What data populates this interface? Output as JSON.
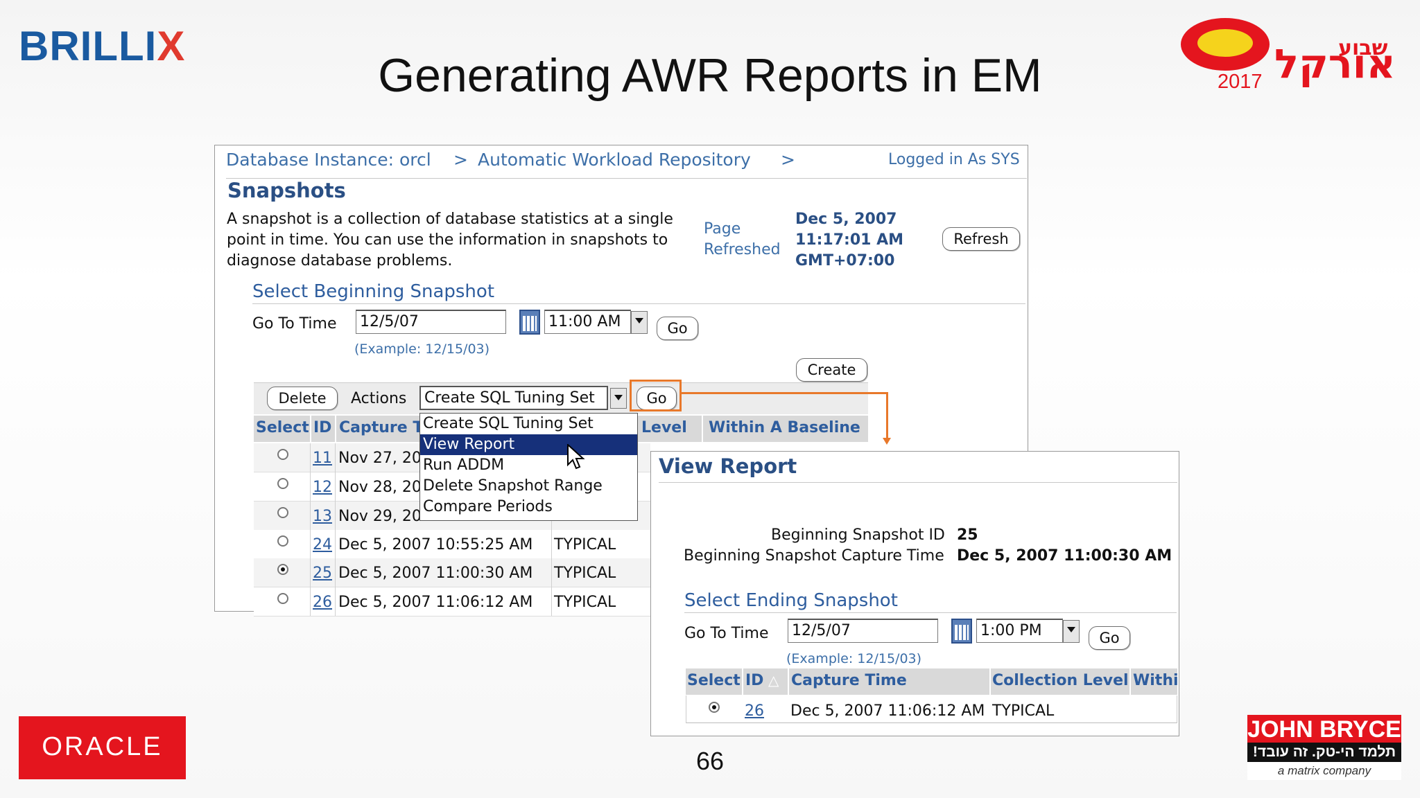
{
  "slide": {
    "title": "Generating AWR Reports in EM",
    "page_number": "66",
    "logos": {
      "brillix_main": "BRILLI",
      "brillix_x": "X",
      "oracle": "ORACLE",
      "john_bryce": "JOHN BRYCE",
      "john_bryce_tagline": "!תלמד הי-טק. זה עובד",
      "john_bryce_company": "a matrix company",
      "orakel_small": "שבוע",
      "orakel_main": "אורקל",
      "orakel_year": "2017"
    },
    "colors": {
      "accent_red": "#e4151e",
      "brillix_blue": "#1a5aa0",
      "highlight_orange": "#e8782a",
      "menu_selected": "#16307a"
    }
  },
  "snapshots_page": {
    "breadcrumb": {
      "item1": "Database Instance: orcl",
      "sep1": ">",
      "item2": "Automatic Workload Repository",
      "sep2": ">"
    },
    "logged_in": "Logged in As SYS",
    "heading": "Snapshots",
    "description": [
      "A snapshot is a collection of database statistics at a single",
      "point in time. You can use the information in snapshots to",
      "diagnose database problems."
    ],
    "page_refreshed_label": [
      "Page",
      "Refreshed"
    ],
    "refreshed_time": [
      "Dec 5, 2007",
      "11:17:01 AM",
      "GMT+07:00"
    ],
    "refresh_button": "Refresh",
    "section_title": "Select Beginning Snapshot",
    "go_to_time_label": "Go To Time",
    "date_value": "12/5/07",
    "time_value": "11:00 AM",
    "go_button": "Go",
    "example_hint": "(Example: 12/15/03)",
    "create_button": "Create",
    "delete_button": "Delete",
    "actions_label": "Actions",
    "actions_selected": "Create SQL Tuning Set",
    "actions_go_button": "Go",
    "actions_menu": [
      "Create SQL Tuning Set",
      "View Report",
      "Run ADDM",
      "Delete Snapshot Range",
      "Compare Periods"
    ],
    "columns": [
      "Select",
      "ID",
      "Capture T",
      "Level",
      "Within A Baseline"
    ],
    "rows": [
      {
        "id": "11",
        "capture": "Nov 27, 20",
        "level": "",
        "selected": false
      },
      {
        "id": "12",
        "capture": "Nov 28, 20",
        "level": "",
        "selected": false
      },
      {
        "id": "13",
        "capture": "Nov 29, 20",
        "level": "",
        "selected": false
      },
      {
        "id": "24",
        "capture": "Dec 5, 2007 10:55:25 AM",
        "level": "TYPICAL",
        "selected": false
      },
      {
        "id": "25",
        "capture": "Dec 5, 2007 11:00:30 AM",
        "level": "TYPICAL",
        "selected": true
      },
      {
        "id": "26",
        "capture": "Dec 5, 2007 11:06:12 AM",
        "level": "TYPICAL",
        "selected": false
      }
    ]
  },
  "view_report": {
    "heading": "View Report",
    "begin_id_label": "Beginning Snapshot ID",
    "begin_id_value": "25",
    "begin_time_label": "Beginning Snapshot Capture Time",
    "begin_time_value": "Dec 5, 2007 11:00:30 AM",
    "section_title": "Select Ending Snapshot",
    "go_to_time_label": "Go To Time",
    "date_value": "12/5/07",
    "time_value": "1:00 PM",
    "go_button": "Go",
    "example_hint": "(Example: 12/15/03)",
    "columns": [
      "Select",
      "ID",
      "Capture Time",
      "Collection Level",
      "Withi"
    ],
    "sort_icon": "△",
    "row": {
      "id": "26",
      "capture": "Dec 5, 2007 11:06:12 AM",
      "level": "TYPICAL",
      "selected": true
    }
  }
}
